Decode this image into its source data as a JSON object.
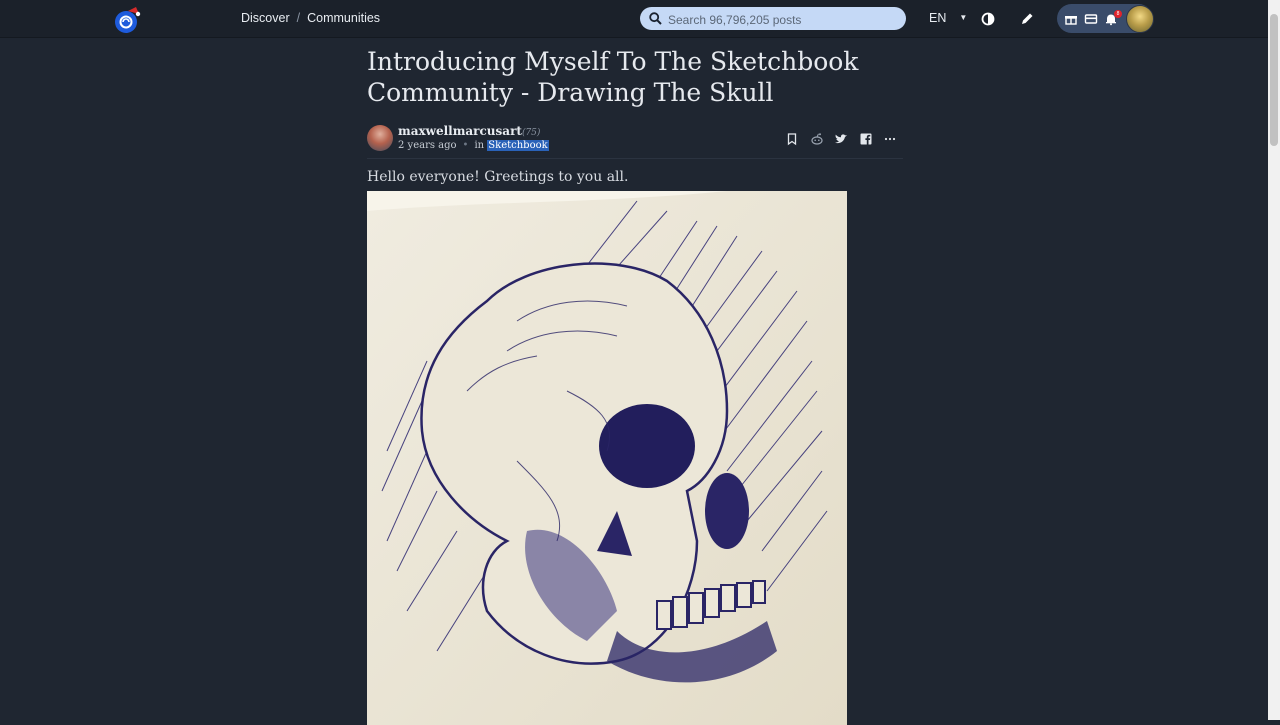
{
  "nav": {
    "discover": "Discover",
    "separator": "/",
    "communities": "Communities"
  },
  "search": {
    "placeholder": "Search 96,796,205 posts"
  },
  "language": "EN",
  "notifications": {
    "count": "8"
  },
  "post": {
    "title": "Introducing Myself To The Sketchbook Community - Drawing The Skull",
    "author": "maxwellmarcusart",
    "reputation": "(75)",
    "time": "2 years ago",
    "in_label": "in",
    "community": "Sketchbook",
    "greeting": "Hello everyone! Greetings to you all."
  },
  "icons": {
    "logo": "brand-logo",
    "search": "search-icon",
    "theme": "contrast-icon",
    "write": "pencil-icon",
    "gift": "gift-icon",
    "wallet": "wallet-icon",
    "bell": "bell-icon",
    "bookmark": "bookmark-icon",
    "reddit": "reddit-icon",
    "twitter": "twitter-icon",
    "facebook": "facebook-icon",
    "more": "more-icon"
  },
  "colors": {
    "background": "#1f2631",
    "topbar": "#1b212a",
    "search_bg": "#c5d9f6",
    "user_pill": "#3a4c6a",
    "community_highlight": "#2a62b8",
    "notification_badge": "#e0242c"
  }
}
